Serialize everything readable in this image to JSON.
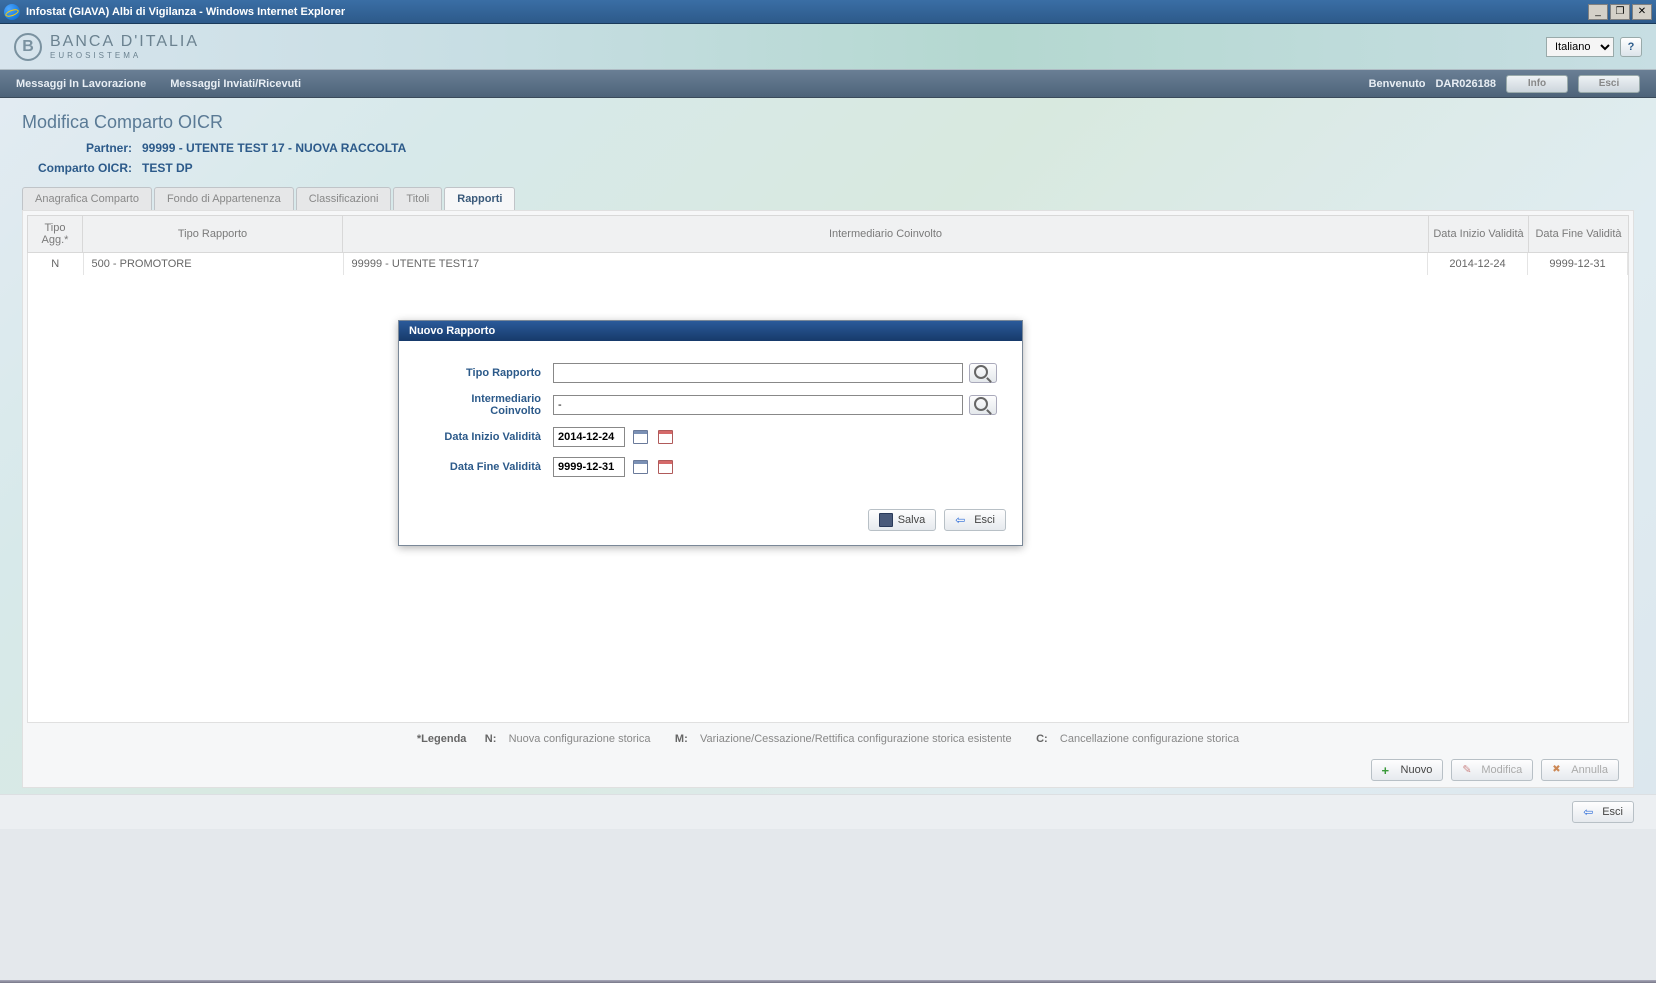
{
  "window": {
    "title": "Infostat (GIAVA) Albi di Vigilanza - Windows Internet Explorer"
  },
  "header": {
    "brand": "BANCA D'ITALIA",
    "subbrand": "EUROSISTEMA",
    "language": "Italiano"
  },
  "navbar": {
    "item1": "Messaggi In Lavorazione",
    "item2": "Messaggi Inviati/Ricevuti",
    "welcome": "Benvenuto",
    "user": "DAR026188",
    "btn_info": "Info",
    "btn_esci": "Esci"
  },
  "page": {
    "title": "Modifica Comparto OICR",
    "partner_label": "Partner:",
    "partner_value": "99999 - UTENTE TEST 17 - NUOVA RACCOLTA",
    "comparto_label": "Comparto OICR:",
    "comparto_value": "TEST DP"
  },
  "tabs": {
    "t1": "Anagrafica Comparto",
    "t2": "Fondo di Appartenenza",
    "t3": "Classificazioni",
    "t4": "Titoli",
    "t5": "Rapporti"
  },
  "grid": {
    "cols": {
      "c1": "Tipo Agg.*",
      "c2": "Tipo Rapporto",
      "c3": "Intermediario Coinvolto",
      "c4": "Data Inizio Validità",
      "c5": "Data Fine Validità"
    },
    "rows": [
      {
        "agg": "N",
        "tipo": "500 - PROMOTORE",
        "inter": "99999 - UTENTE TEST17",
        "inizio": "2014-12-24",
        "fine": "9999-12-31"
      }
    ]
  },
  "legend": {
    "star": "*Legenda",
    "n_k": "N:",
    "n_v": "Nuova configurazione storica",
    "m_k": "M:",
    "m_v": "Variazione/Cessazione/Rettifica configurazione storica esistente",
    "c_k": "C:",
    "c_v": "Cancellazione configurazione storica"
  },
  "actions": {
    "nuovo": "Nuovo",
    "modifica": "Modifica",
    "annulla": "Annulla",
    "esci": "Esci"
  },
  "modal": {
    "title": "Nuovo Rapporto",
    "lbl_tipo": "Tipo Rapporto",
    "val_tipo": "",
    "lbl_inter": "Intermediario Coinvolto",
    "val_inter": "-",
    "lbl_inizio": "Data Inizio Validità",
    "val_inizio": "2014-12-24",
    "lbl_fine": "Data Fine Validità",
    "val_fine": "9999-12-31",
    "btn_salva": "Salva",
    "btn_esci": "Esci"
  }
}
